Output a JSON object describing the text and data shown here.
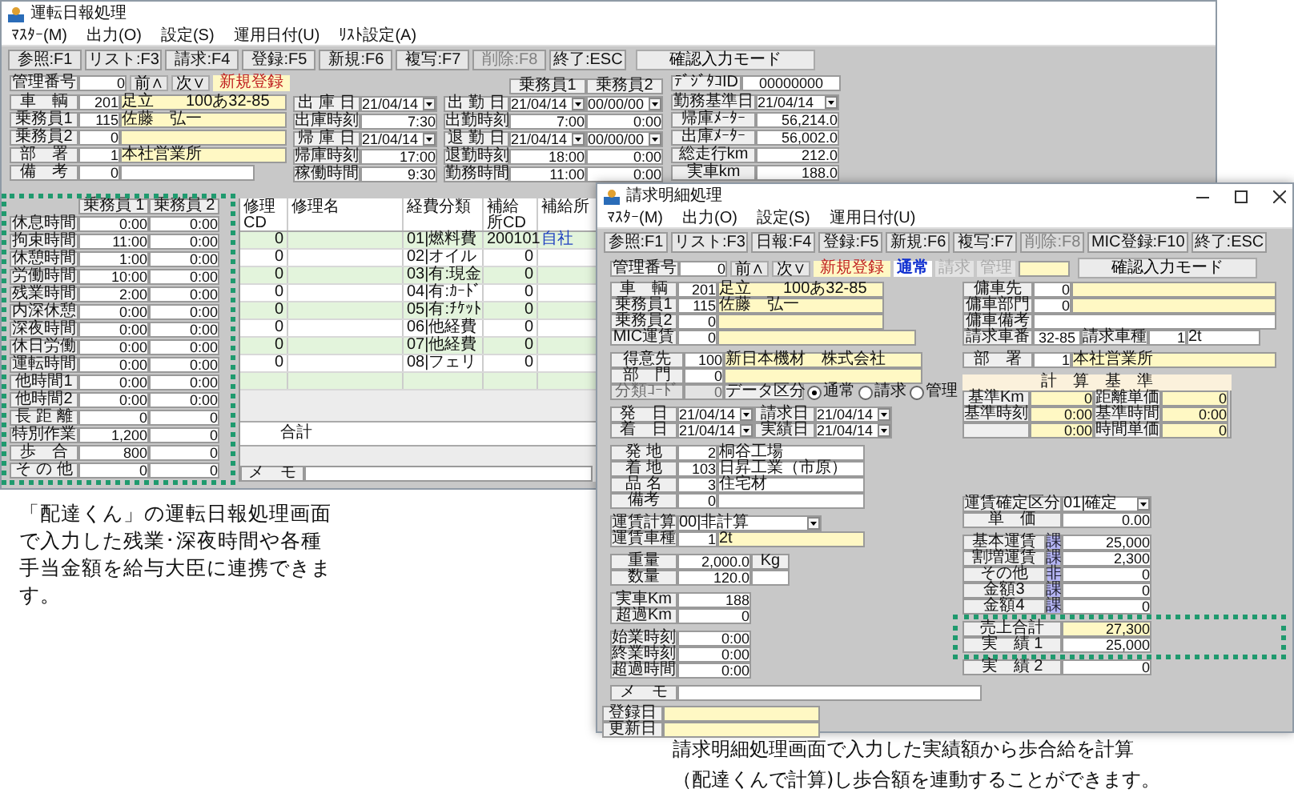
{
  "daily_report_window": {
    "title": "運転日報処理",
    "menu": [
      "ﾏｽﾀｰ(M)",
      "出力(O)",
      "設定(S)",
      "運用日付(U)",
      "ﾘｽﾄ設定(A)"
    ],
    "toolbar": [
      {
        "label": "参照:F1",
        "disabled": false
      },
      {
        "label": "リスト:F3",
        "disabled": false
      },
      {
        "label": "請求:F4",
        "disabled": false
      },
      {
        "label": "登録:F5",
        "disabled": false
      },
      {
        "label": "新規:F6",
        "disabled": false
      },
      {
        "label": "複写:F7",
        "disabled": false
      },
      {
        "label": "削除:F8",
        "disabled": true
      },
      {
        "label": "終了:ESC",
        "disabled": false
      }
    ],
    "mode_button": "確認入力モード",
    "record_bar": {
      "label": "管理番号",
      "value": "0",
      "prev": "前∧",
      "next": "次∨",
      "status": "新規登録"
    },
    "vehicle_fields": [
      {
        "label": "車　輌",
        "code": "201",
        "name": "足立　　100あ32-85",
        "kind": "lookup"
      },
      {
        "label": "乗務員1",
        "code": "115",
        "name": "佐藤　弘一",
        "kind": "lookup"
      },
      {
        "label": "乗務員2",
        "code": "0",
        "kind": "lookup"
      },
      {
        "label": "部　署",
        "code": "1",
        "name": "本社営業所",
        "kind": "lookup"
      },
      {
        "label": "備　考",
        "code": "0",
        "kind": "memo"
      }
    ],
    "depot_fields": [
      {
        "label": "出 庫 日",
        "value": "21/04/14",
        "kind": "date"
      },
      {
        "label": "出庫時刻",
        "value": "7:30",
        "kind": "text"
      },
      {
        "label": "帰 庫 日",
        "value": "21/04/14",
        "kind": "date"
      },
      {
        "label": "帰庫時刻",
        "value": "17:00",
        "kind": "text"
      },
      {
        "label": "稼働時間",
        "value": "9:30",
        "kind": "text"
      }
    ],
    "crew_columns": [
      "乗務員1",
      "乗務員2"
    ],
    "attendance_rows": [
      {
        "label": "出 勤 日",
        "kind": "date",
        "values": [
          "21/04/14",
          "00/00/00"
        ]
      },
      {
        "label": "出勤時刻",
        "kind": "text",
        "values": [
          "7:00",
          "0:00"
        ]
      },
      {
        "label": "退 勤 日",
        "kind": "date",
        "values": [
          "21/04/14",
          "00/00/00"
        ]
      },
      {
        "label": "退勤時刻",
        "kind": "text",
        "values": [
          "18:00",
          "0:00"
        ]
      },
      {
        "label": "勤務時間",
        "kind": "text",
        "values": [
          "11:00",
          "0:00"
        ]
      }
    ],
    "digital_tacho": {
      "label": "ﾃﾞｼﾞﾀｺID",
      "value": "00000000"
    },
    "meter_fields": [
      {
        "label": "勤務基準日",
        "value": "21/04/14",
        "kind": "date"
      },
      {
        "label": "帰庫ﾒｰﾀｰ",
        "value": "56,214.0",
        "kind": "text"
      },
      {
        "label": "出庫ﾒｰﾀｰ",
        "value": "56,002.0",
        "kind": "text"
      },
      {
        "label": "総走行km",
        "value": "212.0",
        "kind": "text"
      },
      {
        "label": "実車km",
        "value": "188.0",
        "kind": "text"
      }
    ],
    "time_table": {
      "columns": [
        "乗務員 1",
        "乗務員 2"
      ],
      "rows": [
        {
          "label": "休息時間",
          "values": [
            "0:00",
            "0:00"
          ]
        },
        {
          "label": "拘束時間",
          "values": [
            "11:00",
            "0:00"
          ]
        },
        {
          "label": "休憩時間",
          "values": [
            "1:00",
            "0:00"
          ]
        },
        {
          "label": "労働時間",
          "values": [
            "10:00",
            "0:00"
          ]
        },
        {
          "label": "残業時間",
          "values": [
            "2:00",
            "0:00"
          ]
        },
        {
          "label": "内深休憩",
          "values": [
            "0:00",
            "0:00"
          ]
        },
        {
          "label": "深夜時間",
          "values": [
            "0:00",
            "0:00"
          ]
        },
        {
          "label": "休日労働",
          "values": [
            "0:00",
            "0:00"
          ]
        },
        {
          "label": "運転時間",
          "values": [
            "0:00",
            "0:00"
          ]
        },
        {
          "label": "他時間1",
          "values": [
            "0:00",
            "0:00"
          ]
        },
        {
          "label": "他時間2",
          "values": [
            "0:00",
            "0:00"
          ]
        },
        {
          "label": "長 距 離",
          "values": [
            "0",
            "0"
          ]
        },
        {
          "label": "特別作業",
          "values": [
            "1,200",
            "0"
          ]
        },
        {
          "label": "歩　合",
          "values": [
            "800",
            "0"
          ]
        },
        {
          "label": "そ の 他",
          "values": [
            "0",
            "0"
          ]
        }
      ]
    },
    "expense_table": {
      "columns": [
        "修理CD",
        "修理名",
        "経費分類",
        "補給所CD",
        "補給所"
      ],
      "rows": [
        {
          "repair_cd": "0",
          "expense_class": "01|燃料費",
          "depot_cd": "200101",
          "depot": "自社"
        },
        {
          "repair_cd": "0",
          "expense_class": "02|オイル",
          "depot_cd": "0"
        },
        {
          "repair_cd": "0",
          "expense_class": "03|有:現金",
          "depot_cd": "0"
        },
        {
          "repair_cd": "0",
          "expense_class": "04|有:ｶｰﾄﾞ",
          "depot_cd": "0"
        },
        {
          "repair_cd": "0",
          "expense_class": "05|有:ﾁｹｯﾄ",
          "depot_cd": "0"
        },
        {
          "repair_cd": "0",
          "expense_class": "06|他経費",
          "depot_cd": "0"
        },
        {
          "repair_cd": "0",
          "expense_class": "07|他経費",
          "depot_cd": "0"
        },
        {
          "repair_cd": "0",
          "expense_class": "08|フェリ",
          "depot_cd": "0"
        },
        {}
      ],
      "total_label": "合計"
    },
    "memo_label": "メ　モ"
  },
  "billing_window": {
    "title": "請求明細処理",
    "menu": [
      "ﾏｽﾀｰ(M)",
      "出力(O)",
      "設定(S)",
      "運用日付(U)"
    ],
    "toolbar": [
      {
        "label": "参照:F1",
        "disabled": false
      },
      {
        "label": "リスト:F3",
        "disabled": false
      },
      {
        "label": "日報:F4",
        "disabled": false
      },
      {
        "label": "登録:F5",
        "disabled": false
      },
      {
        "label": "新規:F6",
        "disabled": false
      },
      {
        "label": "複写:F7",
        "disabled": false
      },
      {
        "label": "削除:F8",
        "disabled": true
      },
      {
        "label": "MIC登録:F10",
        "disabled": false
      },
      {
        "label": "終了:ESC",
        "disabled": false
      }
    ],
    "record_bar": {
      "label": "管理番号",
      "value": "0",
      "prev": "前∧",
      "next": "次∨",
      "status": "新規登録"
    },
    "entry_types": [
      {
        "label": "通常",
        "selected": true
      },
      {
        "label": "請求",
        "selected": false
      },
      {
        "label": "管理",
        "selected": false
      }
    ],
    "mode_button": "確認入力モード",
    "vehicle_fields": [
      {
        "label": "車　輌",
        "code": "201",
        "name": "足立　　100あ32-85",
        "kind": "lookup"
      },
      {
        "label": "乗務員1",
        "code": "115",
        "name": "佐藤　弘一",
        "kind": "lookup"
      },
      {
        "label": "乗務員2",
        "code": "0",
        "kind": "lookup"
      },
      {
        "label": "MIC運賃",
        "code": "0",
        "kind": "wide_lookup"
      }
    ],
    "customer_fields": [
      {
        "label": "得意先",
        "code": "100",
        "name": "新日本機材　株式会社",
        "disabled": false
      },
      {
        "label": "部　門",
        "code": "0",
        "disabled": false
      },
      {
        "label": "分類ｺｰﾄﾞ",
        "code": "0",
        "disabled": true
      }
    ],
    "data_type": {
      "label": "データ区分",
      "options": [
        {
          "label": "通常",
          "selected": true
        },
        {
          "label": "請求",
          "selected": false
        },
        {
          "label": "管理",
          "selected": false
        }
      ]
    },
    "dates": [
      {
        "label": "発　日",
        "value": "21/04/14",
        "label2": "請求日",
        "value2": "21/04/14"
      },
      {
        "label": "着　日",
        "value": "21/04/14",
        "label2": "実績日",
        "value2": "21/04/14"
      }
    ],
    "places": [
      {
        "label": "発 地",
        "code": "2",
        "name": "桐谷工場"
      },
      {
        "label": "着 地",
        "code": "103",
        "name": "日昇工業（市原）"
      },
      {
        "label": "品 名",
        "code": "3",
        "name": "住宅材"
      },
      {
        "label": "備考",
        "code": "0"
      }
    ],
    "fare_calc": {
      "label": "運賃計算",
      "value": "00|非計算"
    },
    "fare_vehicle": {
      "label": "運賃車種",
      "code": "1",
      "name": "2t"
    },
    "weight": {
      "label": "重量",
      "value": "2,000.0",
      "unit": "Kg"
    },
    "quantity": {
      "label": "数量",
      "value": "120.0"
    },
    "distance": [
      {
        "label": "実車Km",
        "value": "188"
      },
      {
        "label": "超過Km",
        "value": "0"
      }
    ],
    "work_times": [
      {
        "label": "始業時刻",
        "value": "0:00"
      },
      {
        "label": "終業時刻",
        "value": "0:00"
      },
      {
        "label": "超過時間",
        "value": "0:00"
      }
    ],
    "charter_fields": [
      {
        "label": "傭車先",
        "code": "0",
        "kind": "lookup"
      },
      {
        "label": "傭車部門",
        "code": "0",
        "kind": "lookup"
      },
      {
        "label": "傭車備考",
        "kind": "text"
      }
    ],
    "billing_plate": {
      "label": "請求車番",
      "value": "32-85",
      "type_label": "請求車種",
      "type_code": "1",
      "type_name": "2t"
    },
    "department": {
      "label": "部　署",
      "code": "1",
      "name": "本社営業所"
    },
    "calc_basis": {
      "title": "計　算　基　準",
      "rows": [
        {
          "label": "基準Km",
          "value": "0",
          "label2": "距離単価",
          "value2": "0"
        },
        {
          "label": "基準時刻",
          "value": "0:00",
          "label2": "基準時間",
          "value2": "0:00"
        },
        {
          "value": "0:00",
          "label2": "時間単価",
          "value2": "0"
        }
      ]
    },
    "fare_settle": {
      "label": "運賃確定区分",
      "value": "01|確定"
    },
    "unit_price": {
      "label": "単　価",
      "value": "0.00"
    },
    "amounts": [
      {
        "label": "基本運賃",
        "tax": "課",
        "value": "25,000"
      },
      {
        "label": "割増運賃",
        "tax": "課",
        "value": "2,300"
      },
      {
        "label": "その他",
        "tax": "非",
        "value": "0"
      },
      {
        "label": "金額3",
        "tax": "課",
        "value": "0"
      },
      {
        "label": "金額4",
        "tax": "課",
        "value": "0"
      }
    ],
    "results": [
      {
        "label": "売上合計",
        "value": "27,300",
        "kind": "total"
      },
      {
        "label": "実　績 1",
        "value": "25,000",
        "kind": "entry"
      },
      {
        "label": "実　績 2",
        "value": "0",
        "kind": "entry"
      }
    ],
    "memo_label": "メ　モ",
    "record_dates": [
      {
        "label": "登録日"
      },
      {
        "label": "更新日"
      }
    ]
  },
  "captions": [
    "「配達くん」の運転日報処理画面で入力した残業･深夜時間や各種手当金額を給与大臣に連携できます。",
    "請求明細処理画面で入力した実績額から歩合給を計算",
    "（配達くんで計算)し歩合額を連動することができます。"
  ]
}
